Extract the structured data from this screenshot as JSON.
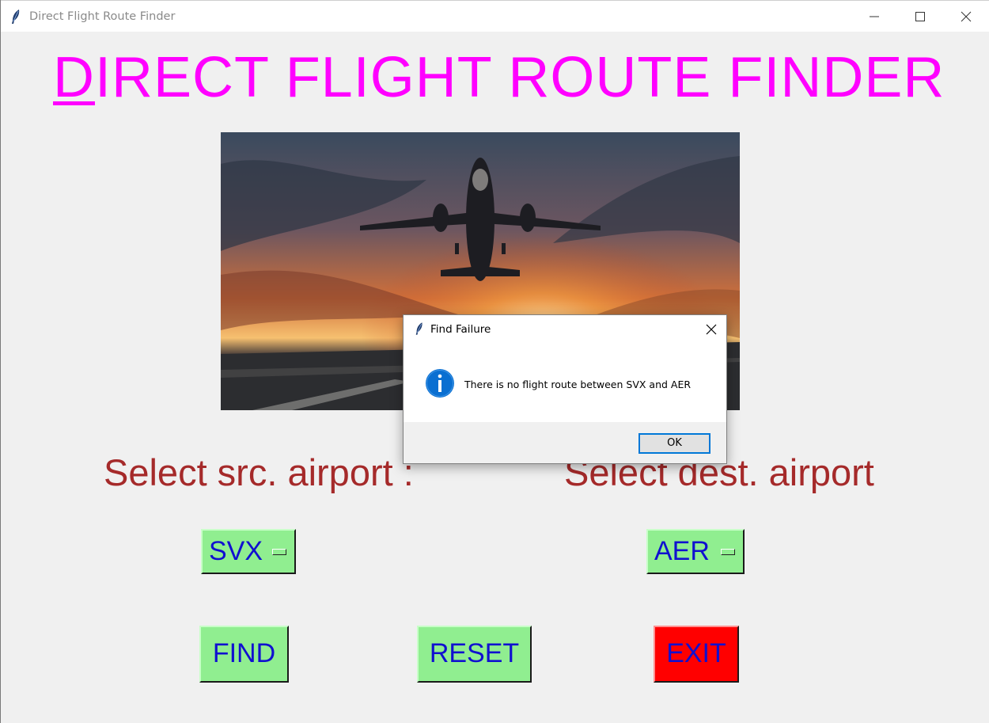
{
  "window": {
    "title": "Direct Flight Route Finder"
  },
  "heading": {
    "first_letter": "D",
    "rest": "IRECT FLIGHT ROUTE FINDER"
  },
  "labels": {
    "source": "Select src. airport :",
    "destination": "Select dest. airport"
  },
  "source_menu": {
    "selected": "SVX"
  },
  "destination_menu": {
    "selected": "AER"
  },
  "buttons": {
    "find": "FIND",
    "reset": "RESET",
    "exit": "EXIT"
  },
  "dialog": {
    "title": "Find Failure",
    "message": "There is no flight route between SVX and AER",
    "ok_label": "OK",
    "icon": "info-icon"
  },
  "colors": {
    "heading": "#ff00ff",
    "label": "#a52a2a",
    "button_green": "#90ee90",
    "button_red": "#ff0000",
    "button_text": "#1010d0"
  }
}
